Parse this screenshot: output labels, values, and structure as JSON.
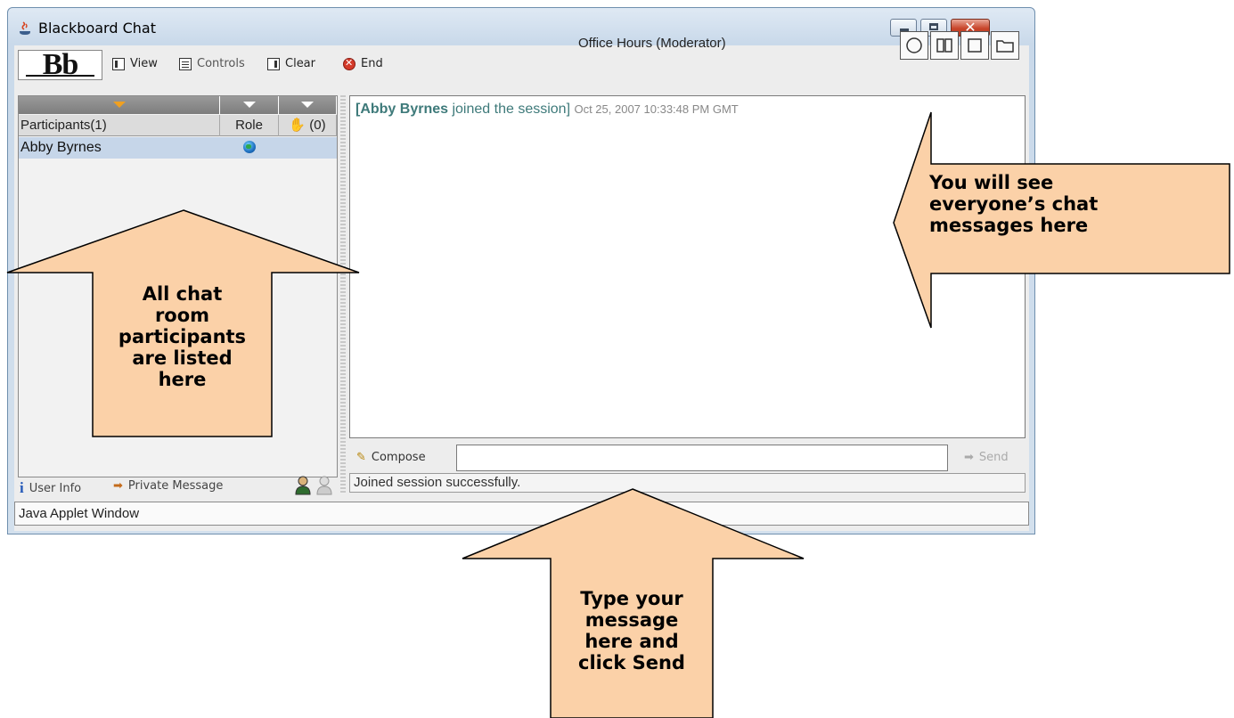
{
  "window": {
    "title": "Blackboard Chat",
    "close_glyph": "✕"
  },
  "toolbar": {
    "logo_text": "Bb",
    "view_label": "View",
    "controls_label": "Controls",
    "clear_label": "Clear",
    "end_label": "End",
    "session_title": "Office Hours (Moderator)"
  },
  "participants": {
    "header_name": "Participants(1)",
    "header_role": "Role",
    "header_hand": "(0)",
    "rows": [
      {
        "name": "Abby Byrnes",
        "role_icon": "globe-icon"
      }
    ]
  },
  "footer": {
    "user_info_label": "User Info",
    "private_message_label": "Private Message"
  },
  "chat": {
    "message_user": "[Abby Byrnes",
    "message_text": " joined the session]",
    "message_time": "Oct 25, 2007 10:33:48 PM GMT",
    "compose_label": "Compose",
    "compose_value": "",
    "send_label": "Send",
    "status": "Joined session successfully."
  },
  "applet_status": "Java Applet Window",
  "callouts": {
    "participants": [
      "All chat",
      "room",
      "participants",
      "are listed",
      "here"
    ],
    "messages": [
      "You will see",
      "everyone’s chat",
      "messages here"
    ],
    "compose": [
      "Type your",
      "message",
      "here and",
      "click Send"
    ]
  },
  "colors": {
    "callout_fill": "#fbd1a8",
    "selected_row": "#c6d6e9",
    "message_text": "#3e7a7a"
  }
}
